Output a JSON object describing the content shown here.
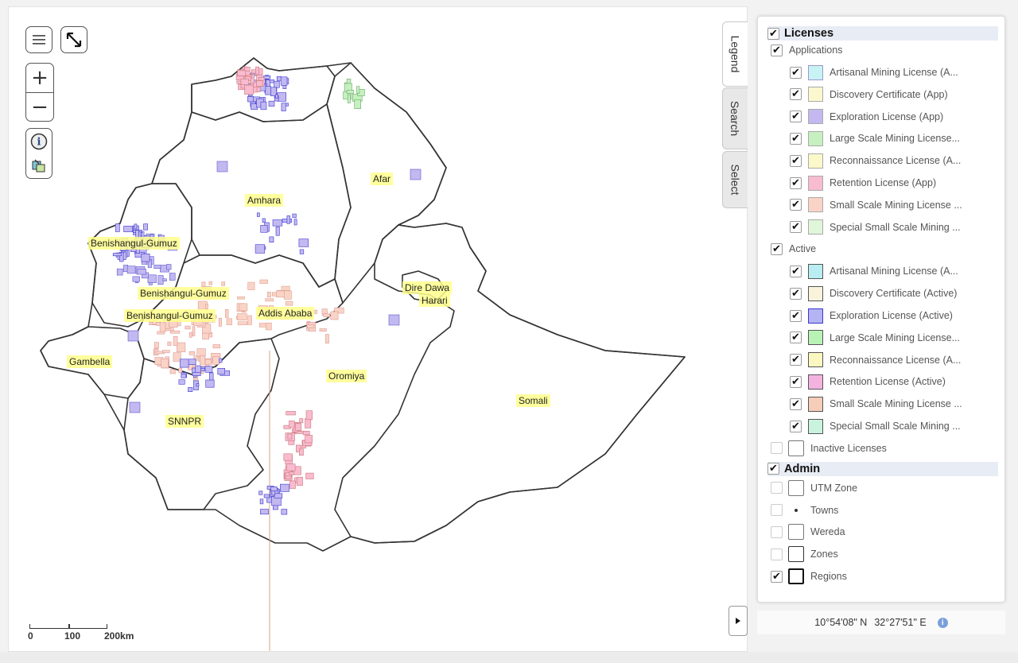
{
  "map": {
    "regions": {
      "tigray": "",
      "afar": "Afar",
      "amhara": "Amhara",
      "benishangul_1": "Benishangul-Gumuz",
      "benishangul_2": "Benishangul-Gumuz",
      "benishangul_3": "Benishangul-Gumuz",
      "addis_ababa": "Addis Ababa",
      "dire_dawa": "Dire Dawa",
      "harari": "Harari",
      "gambella": "Gambella",
      "oromiya": "Oromiya",
      "somali": "Somali",
      "snnpr": "SNNPR"
    },
    "scalebar": {
      "l0": "0",
      "l1": "100",
      "l2": "200km"
    },
    "controls": {
      "layers_icon": "hamburger-icon",
      "fullscreen_icon": "expand-icon",
      "zoom_in": "+",
      "zoom_out": "−",
      "info_icon": "info-icon",
      "identify_icon": "identify-icon"
    }
  },
  "tabs": {
    "legend": "Legend",
    "search": "Search",
    "select": "Select"
  },
  "legend": {
    "licenses": {
      "title": "Licenses",
      "applications": {
        "label": "Applications",
        "items": [
          {
            "label": "Artisanal Mining License (A...",
            "color": "#c9f2f5",
            "border": "#99c",
            "checked": true
          },
          {
            "label": "Discovery Certificate (App)",
            "color": "#fbf7cf",
            "border": "#aaa",
            "checked": true
          },
          {
            "label": "Exploration License (App)",
            "color": "#c3b8f0",
            "border": "#aaa",
            "checked": true
          },
          {
            "label": "Large Scale Mining License...",
            "color": "#c7f0c1",
            "border": "#aaa",
            "checked": true
          },
          {
            "label": "Reconnaissance License (A...",
            "color": "#fbf8c9",
            "border": "#aaa",
            "checked": true
          },
          {
            "label": "Retention License (App)",
            "color": "#f8bbd0",
            "border": "#aaa",
            "checked": true
          },
          {
            "label": "Small Scale Mining License ...",
            "color": "#f9d4c6",
            "border": "#aaa",
            "checked": true
          },
          {
            "label": "Special Small Scale Mining ...",
            "color": "#dff6d8",
            "border": "#aaa",
            "checked": true
          }
        ]
      },
      "active": {
        "label": "Active",
        "items": [
          {
            "label": "Artisanal Mining License (A...",
            "color": "#b8eef2",
            "border": "#555",
            "checked": true
          },
          {
            "label": "Discovery Certificate (Active)",
            "color": "#faf3dc",
            "border": "#555",
            "checked": true
          },
          {
            "label": "Exploration License (Active)",
            "color": "#b5b3f2",
            "border": "#3a3ad0",
            "checked": true
          },
          {
            "label": "Large Scale Mining License...",
            "color": "#b9f2b5",
            "border": "#555",
            "checked": true
          },
          {
            "label": "Reconnaissance License (A...",
            "color": "#fbf7c0",
            "border": "#555",
            "checked": true
          },
          {
            "label": "Retention License (Active)",
            "color": "#f4b2df",
            "border": "#555",
            "checked": true
          },
          {
            "label": "Small Scale Mining License ...",
            "color": "#f6cdb9",
            "border": "#555",
            "checked": true
          },
          {
            "label": "Special Small Scale Mining ...",
            "color": "#c9f2df",
            "border": "#555",
            "checked": true
          }
        ]
      },
      "inactive": {
        "label": "Inactive Licenses",
        "checked": false
      }
    },
    "admin": {
      "title": "Admin",
      "items": [
        {
          "label": "UTM Zone",
          "checked": false,
          "swatch": "box"
        },
        {
          "label": "Towns",
          "checked": false,
          "swatch": "dot"
        },
        {
          "label": "Wereda",
          "checked": false,
          "swatch": "box"
        },
        {
          "label": "Zones",
          "checked": false,
          "swatch": "box-dark"
        },
        {
          "label": "Regions",
          "checked": true,
          "swatch": "box-bold"
        }
      ]
    }
  },
  "coordinates": {
    "lat": "10°54'08\" N",
    "lon": "32°27'51\" E"
  },
  "colors": {
    "panel_header": "#e8ecf4",
    "label_bg": "#ffff8c",
    "border": "#333333"
  }
}
